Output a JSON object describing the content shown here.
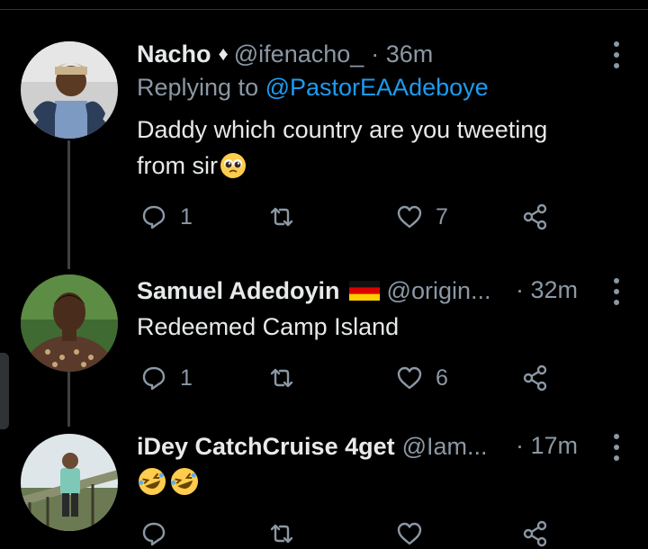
{
  "tweets": [
    {
      "name": "Nacho",
      "badge": "♦",
      "handle": "@ifenacho_",
      "time": "· 36m",
      "replying_prefix": "Replying to ",
      "replying_to": "@PastorEAAdeboye",
      "text_line1": "Daddy which country are you tweeting",
      "text_line2": "from sir",
      "emoji": "pleading-face",
      "replies": "1",
      "retweets": "",
      "likes": "7"
    },
    {
      "name": "Samuel Adedoyin",
      "flag": "germany-flag",
      "handle": "@origin...",
      "time": "· 32m",
      "text": "Redeemed Camp Island",
      "replies": "1",
      "retweets": "",
      "likes": "6"
    },
    {
      "name": "iDey CatchCruise 4get",
      "handle": "@Iam...",
      "time": "· 17m",
      "emoji": "rolling-on-floor-laughing x2",
      "replies": "",
      "retweets": "",
      "likes": ""
    }
  ],
  "colors": {
    "background": "#000000",
    "text": "#e7e9ea",
    "secondary": "#8b98a5",
    "link": "#1d9bf0",
    "thread_line": "#3e4144"
  }
}
